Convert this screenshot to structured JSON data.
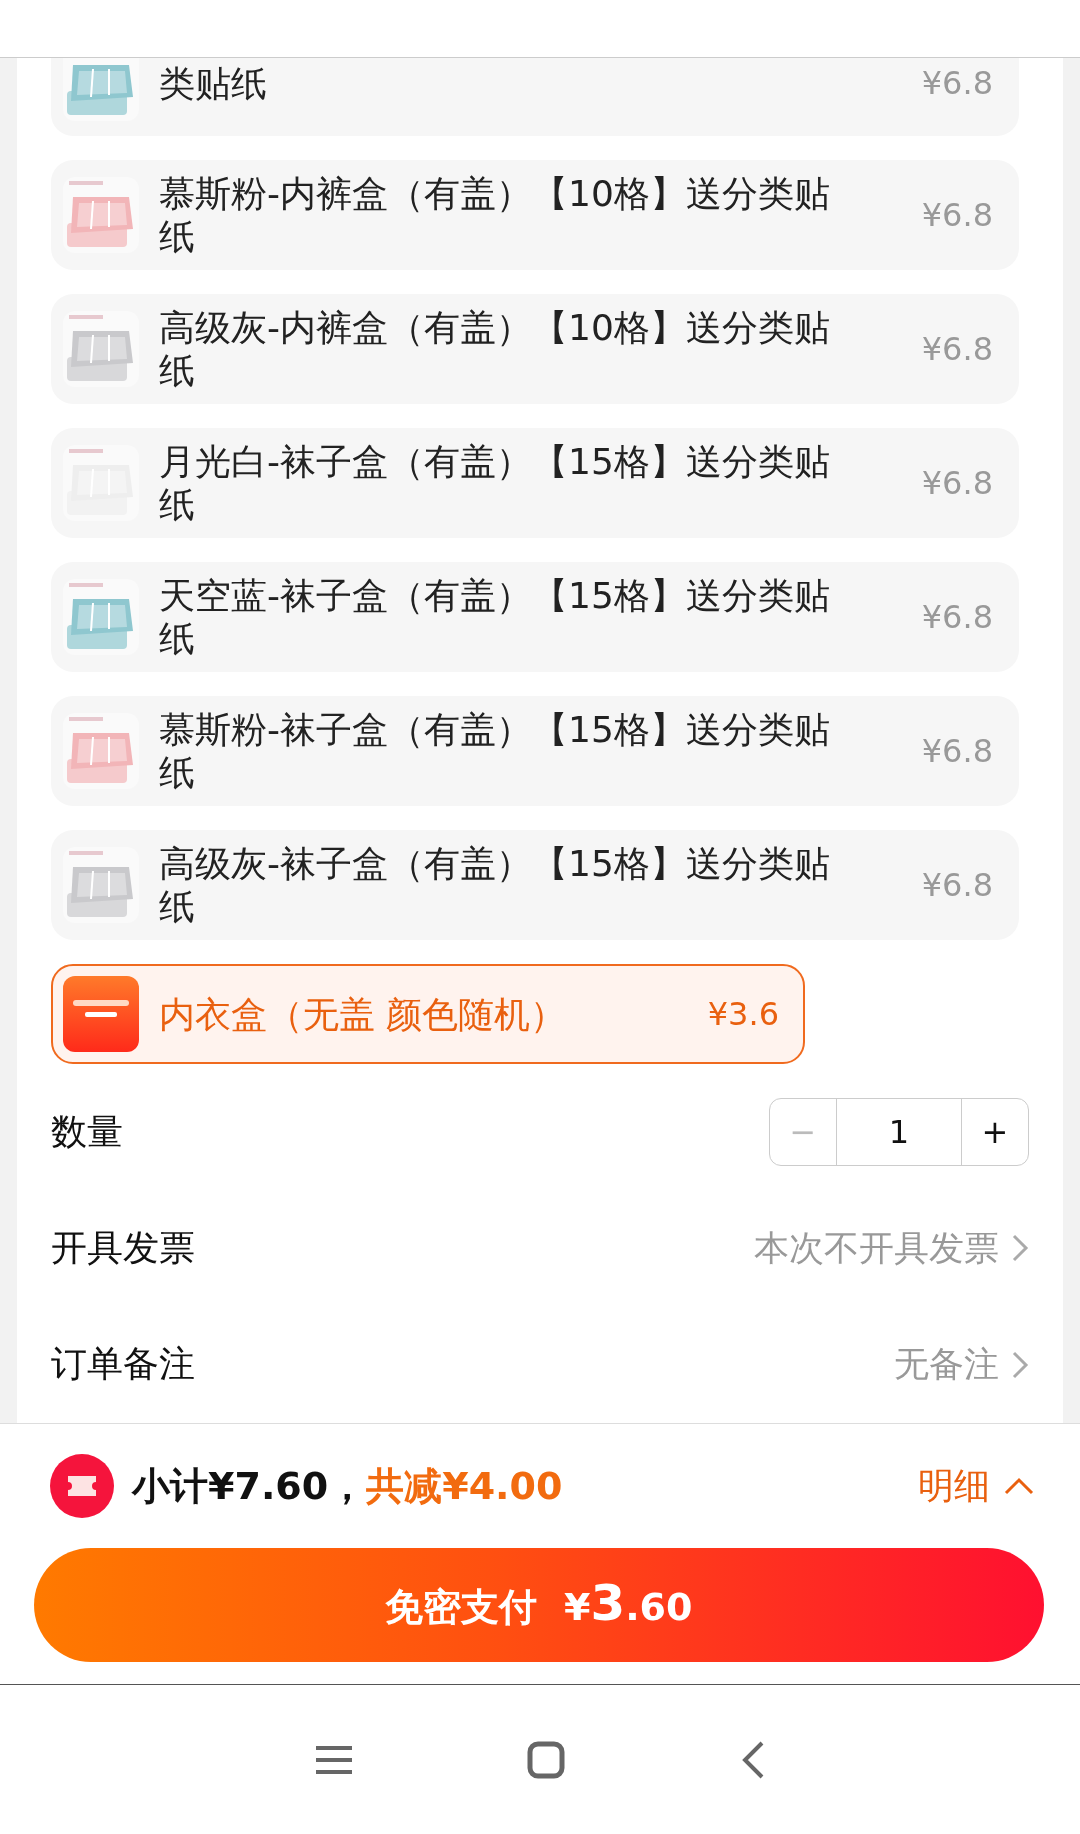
{
  "options": [
    {
      "name": "类贴纸",
      "price": "¥6.8",
      "selected": false
    },
    {
      "name": "慕斯粉-内裤盒（有盖）【10格】送分类贴纸",
      "price": "¥6.8",
      "selected": false
    },
    {
      "name": "高级灰-内裤盒（有盖）【10格】送分类贴纸",
      "price": "¥6.8",
      "selected": false
    },
    {
      "name": "月光白-袜子盒（有盖）【15格】送分类贴纸",
      "price": "¥6.8",
      "selected": false
    },
    {
      "name": "天空蓝-袜子盒（有盖）【15格】送分类贴纸",
      "price": "¥6.8",
      "selected": false
    },
    {
      "name": "慕斯粉-袜子盒（有盖）【15格】送分类贴纸",
      "price": "¥6.8",
      "selected": false
    },
    {
      "name": "高级灰-袜子盒（有盖）【15格】送分类贴纸",
      "price": "¥6.8",
      "selected": false
    },
    {
      "name": "内衣盒（无盖 颜色随机）",
      "price": "¥3.6",
      "selected": true
    }
  ],
  "quantity": {
    "label": "数量",
    "minus": "−",
    "value": "1",
    "plus": "+",
    "minus_disabled": true
  },
  "rows": [
    {
      "label": "开具发票",
      "value": "本次不开具发票"
    },
    {
      "label": "订单备注",
      "value": "无备注"
    }
  ],
  "summary": {
    "subtotal": "小计¥7.60，",
    "discount": "共减¥4.00",
    "details": "明细"
  },
  "pay_button": {
    "label": "免密支付",
    "currency": "¥",
    "amount_int": "3",
    "amount_dec": ".60"
  }
}
